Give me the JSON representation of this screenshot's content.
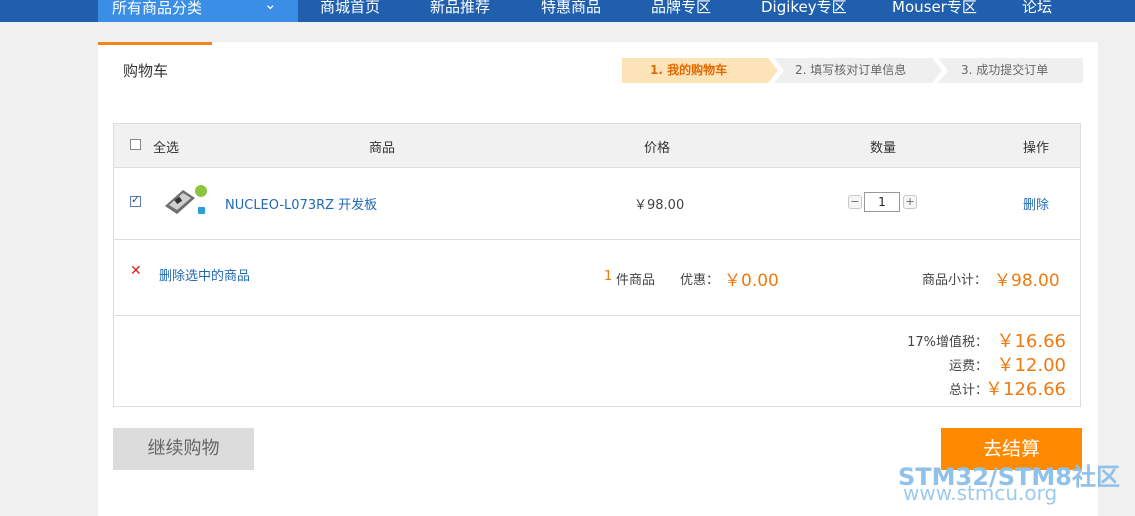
{
  "nav": {
    "category_label": "所有商品分类",
    "items": [
      "商城首页",
      "新品推荐",
      "特惠商品",
      "品牌专区",
      "Digikey专区",
      "Mouser专区",
      "论坛"
    ]
  },
  "page": {
    "title": "购物车"
  },
  "steps": [
    {
      "label": "1. 我的购物车",
      "active": true
    },
    {
      "label": "2. 填写核对订单信息",
      "active": false
    },
    {
      "label": "3. 成功提交订单",
      "active": false
    }
  ],
  "table": {
    "headers": {
      "select_all": "全选",
      "product": "商品",
      "price": "价格",
      "quantity": "数量",
      "action": "操作"
    },
    "items": [
      {
        "name": "NUCLEO-L073RZ 开发板",
        "price": "￥98.00",
        "quantity": "1",
        "delete": "删除",
        "checked": true
      }
    ]
  },
  "summary": {
    "delete_selected": "删除选中的商品",
    "item_count": "1",
    "item_count_suffix": "件商品",
    "discount_label": "优惠：",
    "discount_value": "￥0.00",
    "subtotal_label": "商品小计：",
    "subtotal_value": "￥98.00",
    "tax_label": "17%增值税：",
    "tax_value": "￥16.66",
    "shipping_label": "运费：",
    "shipping_value": "￥12.00",
    "total_label": "总计：",
    "total_value": "￥126.66"
  },
  "buttons": {
    "continue": "继续购物",
    "checkout": "去结算"
  },
  "watermark": {
    "line1": "STM32/STM8社区",
    "line2": "www.stmcu.org"
  },
  "colors": {
    "nav": "#1f5fae",
    "accent": "#f08519",
    "link": "#2269b5",
    "checkout": "#ff8a00"
  }
}
